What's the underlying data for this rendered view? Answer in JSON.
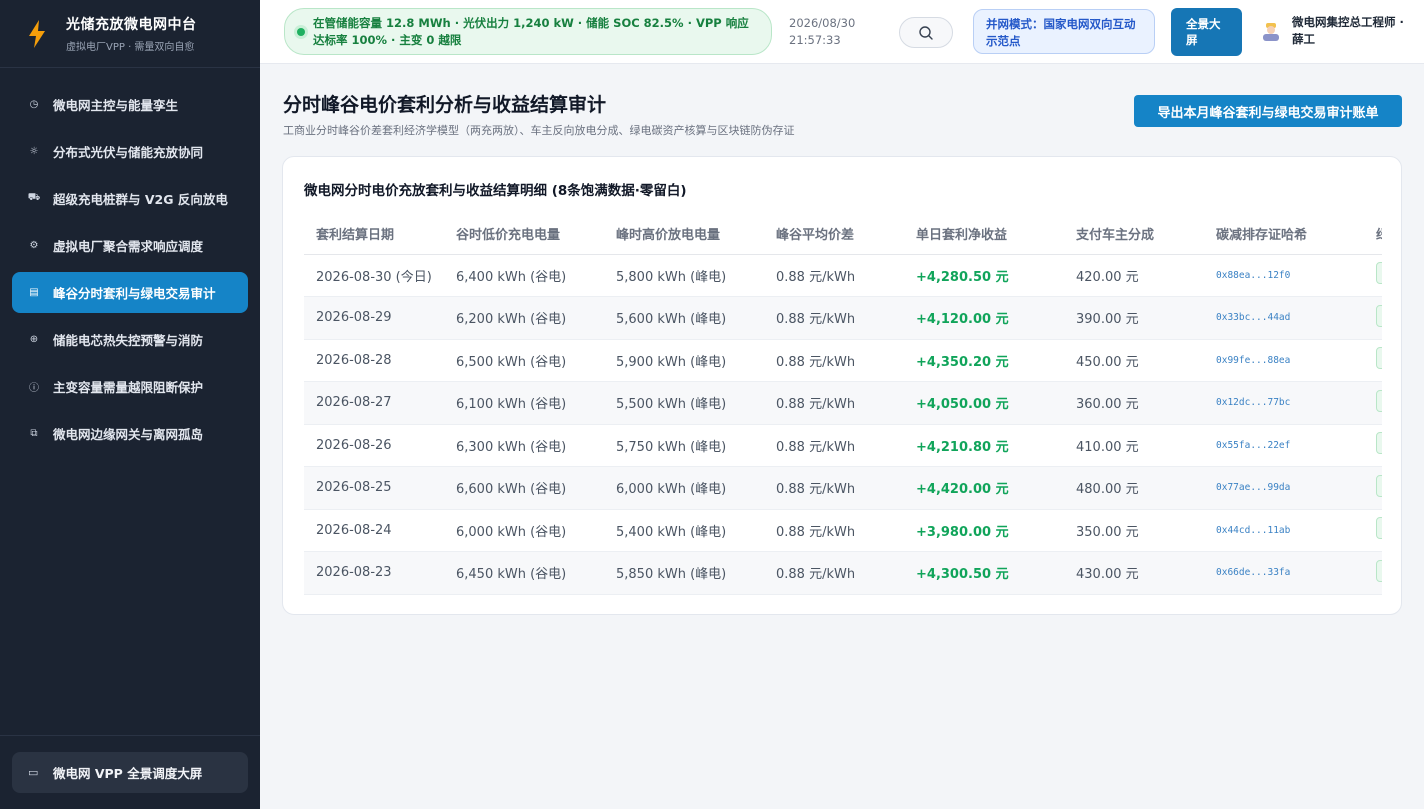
{
  "brand": {
    "title": "光储充放微电网中台",
    "subtitle": "虚拟电厂VPP · 需量双向自愈"
  },
  "nav": [
    {
      "label": "微电网主控与能量孪生",
      "icon": "gauge-icon",
      "glyph": "◷",
      "active": false
    },
    {
      "label": "分布式光伏与储能充放协同",
      "icon": "sun-icon",
      "glyph": "☼",
      "active": false
    },
    {
      "label": "超级充电桩群与 V2G 反向放电",
      "icon": "truck-icon",
      "glyph": "⛟",
      "active": false
    },
    {
      "label": "虚拟电厂聚合需求响应调度",
      "icon": "chip-icon",
      "glyph": "⚙",
      "active": false
    },
    {
      "label": "峰谷分时套利与绿电交易审计",
      "icon": "receipt-icon",
      "glyph": "▤",
      "active": true
    },
    {
      "label": "储能电芯热失控预警与消防",
      "icon": "target-icon",
      "glyph": "⊕",
      "active": false
    },
    {
      "label": "主变容量需量越限阻断保护",
      "icon": "alert-circle-icon",
      "glyph": "ⓘ",
      "active": false
    },
    {
      "label": "微电网边缘网关与离网孤岛",
      "icon": "network-icon",
      "glyph": "⧉",
      "active": false
    }
  ],
  "footer": {
    "label": "微电网 VPP 全景调度大屏",
    "glyph": "▭"
  },
  "topbar": {
    "status": "在管储能容量 12.8 MWh · 光伏出力 1,240 kW · 储能 SOC 82.5% · VPP 响应达标率 100% · 主变 0 越限",
    "date": "2026/08/30",
    "time": "21:57:33",
    "mode": "并网模式：国家电网双向互动示范点",
    "fullscreen": "全景大屏",
    "user": "微电网集控总工程师 · 薛工"
  },
  "page": {
    "title": "分时峰谷电价套利分析与收益结算审计",
    "subtitle": "工商业分时峰谷价差套利经济学模型（两充两放）、车主反向放电分成、绿电碳资产核算与区块链防伪存证",
    "export": "导出本月峰谷套利与绿电交易审计账单"
  },
  "table": {
    "title": "微电网分时电价充放套利与收益结算明细 (8条饱满数据·零留白)",
    "columns": [
      "套利结算日期",
      "谷时低价充电电量",
      "峰时高价放电电量",
      "峰谷平均价差",
      "单日套利净收益",
      "支付车主分成",
      "碳减排存证哈希",
      "绿"
    ],
    "rows": [
      [
        "2026-08-30 (今日)",
        "6,400 kWh (谷电)",
        "5,800 kWh (峰电)",
        "0.88 元/kWh",
        "+4,280.50 元",
        "420.00 元",
        "0x88ea...12f0"
      ],
      [
        "2026-08-29",
        "6,200 kWh (谷电)",
        "5,600 kWh (峰电)",
        "0.88 元/kWh",
        "+4,120.00 元",
        "390.00 元",
        "0x33bc...44ad"
      ],
      [
        "2026-08-28",
        "6,500 kWh (谷电)",
        "5,900 kWh (峰电)",
        "0.88 元/kWh",
        "+4,350.20 元",
        "450.00 元",
        "0x99fe...88ea"
      ],
      [
        "2026-08-27",
        "6,100 kWh (谷电)",
        "5,500 kWh (峰电)",
        "0.88 元/kWh",
        "+4,050.00 元",
        "360.00 元",
        "0x12dc...77bc"
      ],
      [
        "2026-08-26",
        "6,300 kWh (谷电)",
        "5,750 kWh (峰电)",
        "0.88 元/kWh",
        "+4,210.80 元",
        "410.00 元",
        "0x55fa...22ef"
      ],
      [
        "2026-08-25",
        "6,600 kWh (谷电)",
        "6,000 kWh (峰电)",
        "0.88 元/kWh",
        "+4,420.00 元",
        "480.00 元",
        "0x77ae...99da"
      ],
      [
        "2026-08-24",
        "6,000 kWh (谷电)",
        "5,400 kWh (峰电)",
        "0.88 元/kWh",
        "+3,980.00 元",
        "350.00 元",
        "0x44cd...11ab"
      ],
      [
        "2026-08-23",
        "6,450 kWh (谷电)",
        "5,850 kWh (峰电)",
        "0.88 元/kWh",
        "+4,300.50 元",
        "430.00 元",
        "0x66de...33fa"
      ]
    ]
  },
  "colors": {
    "accent": "#1584c7",
    "sidebar": "#1b2331",
    "profit": "#10a45a",
    "status_green": "#1fb060"
  }
}
